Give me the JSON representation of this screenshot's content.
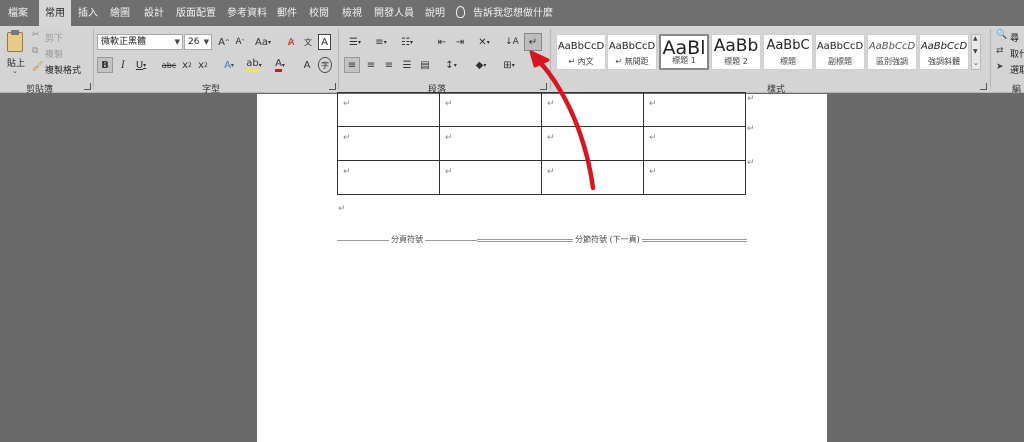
{
  "tabs": {
    "file": "檔案",
    "home": "常用",
    "insert": "插入",
    "draw": "繪圖",
    "design": "設計",
    "layout": "版面配置",
    "references": "參考資料",
    "mailings": "郵件",
    "review": "校閱",
    "view": "檢視",
    "developer": "開發人員",
    "help": "說明",
    "tell_me": "告訴我您想做什麼"
  },
  "clipboard": {
    "paste": "貼上",
    "cut": "剪下",
    "copy": "複製",
    "format_painter": "複製格式",
    "group_label": "剪貼簿"
  },
  "font": {
    "name": "微軟正黑體",
    "size": "26",
    "group_label": "字型"
  },
  "paragraph": {
    "group_label": "段落"
  },
  "styles": {
    "group_label": "樣式",
    "items": [
      {
        "sample": "AaBbCcD",
        "name": "↵ 內文"
      },
      {
        "sample": "AaBbCcD",
        "name": "↵ 無間距"
      },
      {
        "sample": "AaBl",
        "name": "標題 1"
      },
      {
        "sample": "AaBb",
        "name": "標題 2"
      },
      {
        "sample": "AaBbC",
        "name": "標題"
      },
      {
        "sample": "AaBbCcD",
        "name": "副標題"
      },
      {
        "sample": "AaBbCcD",
        "name": "區別強調"
      },
      {
        "sample": "AaBbCcD",
        "name": "強調斜體"
      }
    ]
  },
  "editing": {
    "find": "尋",
    "replace": "取代",
    "select": "選取",
    "group_label": "編"
  },
  "document": {
    "paragraph_mark": "↵",
    "page_break_label": "分頁符號",
    "section_break_label": "分節符號 (下一頁)"
  },
  "colors": {
    "arrow": "#d8161f",
    "ribbon": "#d4d4d4",
    "tabbar": "#6f6f6f",
    "workspace": "#6a6a6a"
  }
}
